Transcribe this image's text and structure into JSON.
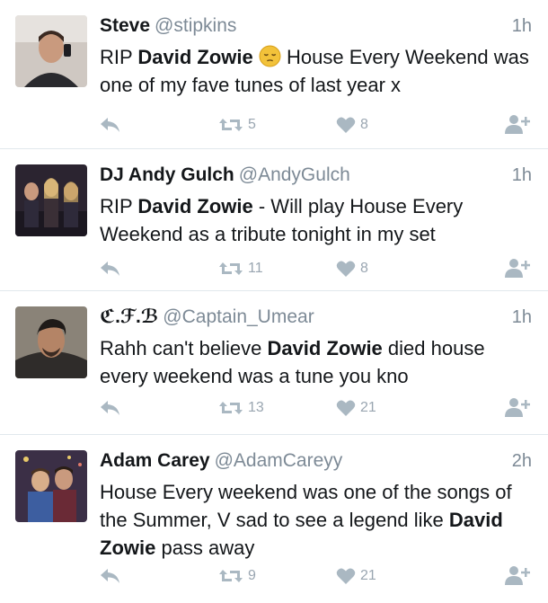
{
  "colors": {
    "text": "#14171a",
    "muted": "#7d8a96",
    "icon": "#aab8c2",
    "divider": "#e1e8ed"
  },
  "tweets": [
    {
      "name": "Steve",
      "handle": "@stipkins",
      "time": "1h",
      "text_before": "RIP ",
      "bold": "David Zowie",
      "text_after": " House Every Weekend was one of my fave tunes of last year x",
      "has_emoji": true,
      "emoji": "pensive-face",
      "retweets": "5",
      "likes": "8"
    },
    {
      "name": "DJ Andy Gulch",
      "handle": "@AndyGulch",
      "time": "1h",
      "text_before": "RIP ",
      "bold": "David Zowie",
      "text_after": " - Will play House Every Weekend as a tribute tonight in my set",
      "has_emoji": false,
      "retweets": "11",
      "likes": "8"
    },
    {
      "name": "ℭ.ℱ.ℬ",
      "handle": "@Captain_Umear",
      "time": "1h",
      "text_before": "Rahh can't believe ",
      "bold": "David Zowie",
      "text_after": " died house every weekend was a tune you kno",
      "has_emoji": false,
      "retweets": "13",
      "likes": "21"
    },
    {
      "name": "Adam Carey",
      "handle": "@AdamCareyy",
      "time": "2h",
      "text_before": "House Every weekend was one of the songs of the Summer, V sad to see a legend like ",
      "bold": "David Zowie",
      "text_after": " pass away",
      "has_emoji": false,
      "retweets": "9",
      "likes": "21"
    }
  ],
  "icons": {
    "reply": "reply-icon",
    "retweet": "retweet-icon",
    "like": "heart-icon",
    "follow": "follow-user-icon"
  }
}
